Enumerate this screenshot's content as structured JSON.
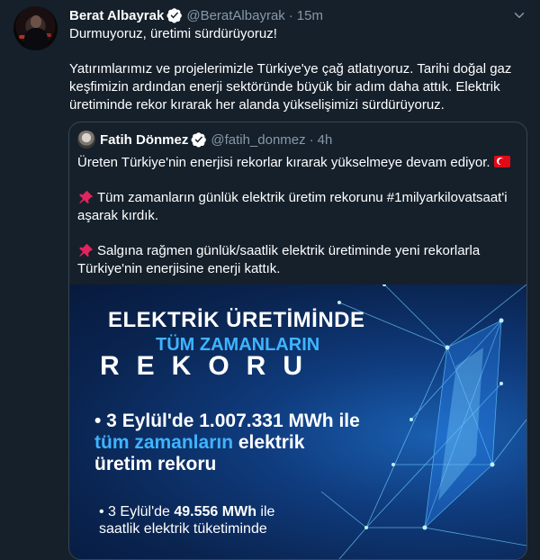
{
  "author": {
    "name": "Berat Albayrak",
    "handle": "@BeratAlbayrak",
    "separator": "·",
    "time": "15m"
  },
  "tweet": {
    "line1": "Durmuyoruz, üretimi sürdürüyoruz!",
    "line2": "Yatırımlarımız ve projelerimizle Türkiye'ye çağ atlatıyoruz. Tarihi doğal gaz keşfimizin ardından enerji sektöründe büyük bir adım daha attık. Elektrik üretiminde rekor kırarak her alanda yükselişimizi sürdürüyoruz."
  },
  "quote": {
    "name": "Fatih Dönmez",
    "handle": "@fatih_donmez",
    "separator": "·",
    "time": "4h",
    "p1": "Üreten Türkiye'nin enerjisi rekorlar kırarak yükselmeye devam ediyor.",
    "p2": "Tüm zamanların günlük elektrik üretim rekorunu #1milyarkilovatsaat'i aşarak kırdık.",
    "p3": "Salgına rağmen günlük/saatlik elektrik üretiminde yeni rekorlarla Türkiye'nin enerjisine enerji kattık."
  },
  "media": {
    "title1": "ELEKTRİK ÜRETİMİNDE",
    "title2": "TÜM ZAMANLARIN",
    "title3": "REKORU",
    "b1_pre": "• 3 Eylül'de 1.007.331 MWh ile ",
    "b1_hl": "tüm zamanların",
    "b1_post": " elektrik üretim rekoru",
    "b2_pre": "• 3 Eylül'de ",
    "b2_bold": "49.556 MWh",
    "b2_post": " ile saatlik elektrik tüketiminde"
  },
  "colors": {
    "background": "#15202b",
    "accent": "#1da1f2",
    "muted": "#8899a6",
    "border": "#38444d"
  }
}
